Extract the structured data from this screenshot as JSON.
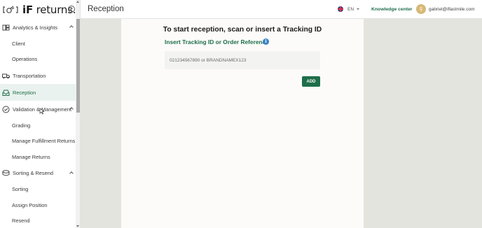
{
  "app": {
    "logo_bold": "iF",
    "logo_light": " returns.",
    "page_title": "Reception"
  },
  "sidebar": {
    "items": [
      {
        "label": "Analytics & Insights",
        "type": "parent",
        "icon": "analytics-icon",
        "expanded": true
      },
      {
        "label": "Client",
        "type": "child"
      },
      {
        "label": "Operations",
        "type": "child"
      },
      {
        "label": "Transportation",
        "type": "parent",
        "icon": "truck-icon"
      },
      {
        "label": "Reception",
        "type": "parent",
        "icon": "inbox-icon",
        "active": true
      },
      {
        "label": "Validation & Management",
        "type": "parent",
        "icon": "check-circle-icon",
        "expanded": true
      },
      {
        "label": "Grading",
        "type": "child"
      },
      {
        "label": "Manage Fulfillment Returns",
        "type": "child"
      },
      {
        "label": "Manage Returns",
        "type": "child"
      },
      {
        "label": "Sorting & Resend",
        "type": "parent",
        "icon": "stack-icon",
        "expanded": true
      },
      {
        "label": "Sorting",
        "type": "child"
      },
      {
        "label": "Assign Position",
        "type": "child"
      },
      {
        "label": "Resend",
        "type": "child"
      }
    ]
  },
  "topbar": {
    "language": "EN",
    "knowledge_center": "Knowledge center",
    "avatar_initial": "g",
    "user_email": "gabriel@iflastmile.com"
  },
  "reception": {
    "heading": "To start reception, scan or insert a Tracking ID",
    "input_label": "Insert Tracking ID or Order Reference",
    "input_placeholder": "021234567890 or BRANDNAMEX123",
    "input_value": "",
    "add_label": "ADD"
  },
  "colors": {
    "brand_green": "#1f6e4a",
    "active_bg": "#e9f2ee",
    "info_blue": "#3b84c4",
    "avatar": "#d8b776"
  }
}
